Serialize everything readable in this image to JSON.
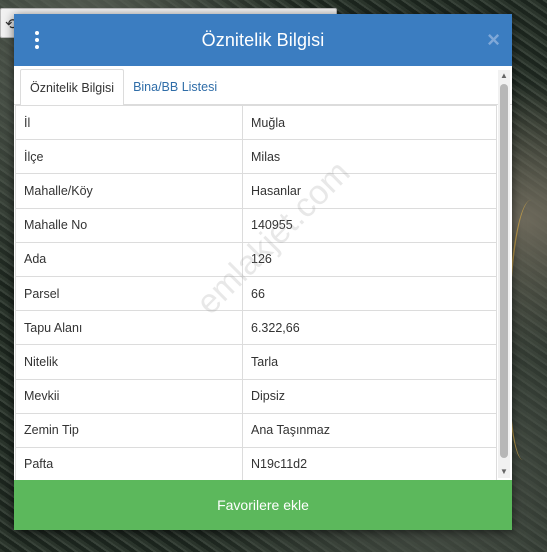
{
  "dialog": {
    "title": "Öznitelik Bilgisi",
    "close_label": "×"
  },
  "tabs": [
    {
      "label": "Öznitelik Bilgisi",
      "active": true
    },
    {
      "label": "Bina/BB Listesi",
      "active": false
    }
  ],
  "attributes": [
    {
      "key": "İl",
      "value": "Muğla"
    },
    {
      "key": "İlçe",
      "value": "Milas"
    },
    {
      "key": "Mahalle/Köy",
      "value": "Hasanlar"
    },
    {
      "key": "Mahalle No",
      "value": "140955"
    },
    {
      "key": "Ada",
      "value": "126"
    },
    {
      "key": "Parsel",
      "value": "66"
    },
    {
      "key": "Tapu Alanı",
      "value": "6.322,66"
    },
    {
      "key": "Nitelik",
      "value": "Tarla"
    },
    {
      "key": "Mevkii",
      "value": "Dipsiz"
    },
    {
      "key": "Zemin Tip",
      "value": "Ana Taşınmaz"
    },
    {
      "key": "Pafta",
      "value": "N19c11d2"
    }
  ],
  "footer": {
    "favorite_label": "Favorilere ekle"
  },
  "watermark": "emlakjet.com",
  "colors": {
    "header": "#3b7dc1",
    "favorite_button": "#5cb85c",
    "tab_link": "#2f6da8"
  }
}
